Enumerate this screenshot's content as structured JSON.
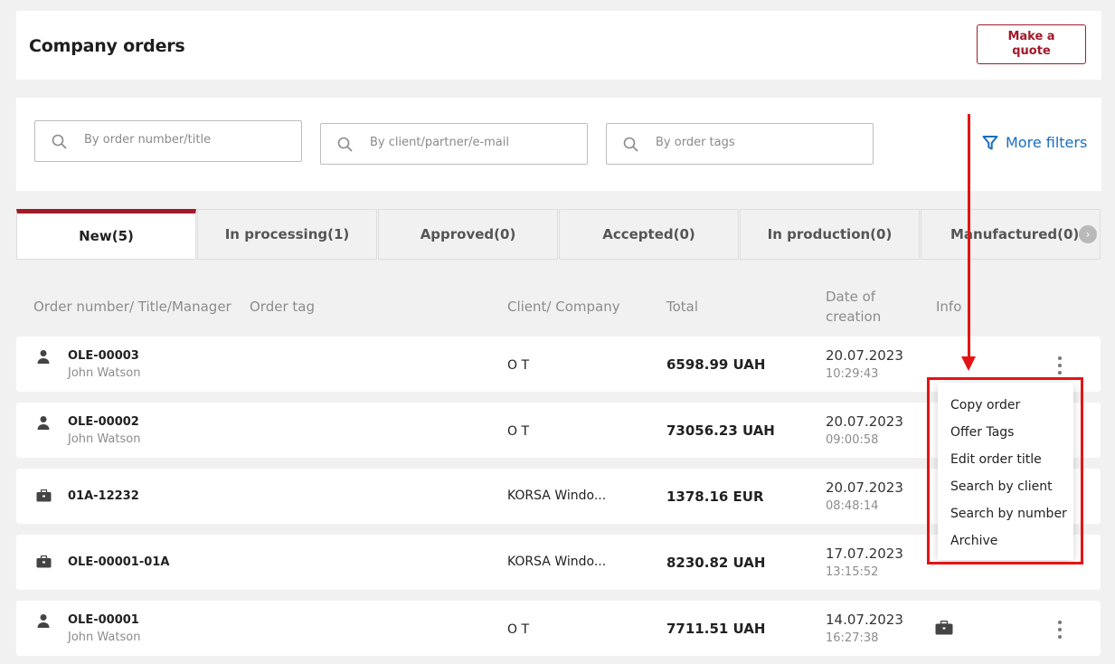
{
  "header": {
    "title": "Company orders",
    "quote_button": "Make a quote"
  },
  "filters": {
    "order_placeholder": "By order number/title",
    "client_placeholder": "By client/partner/e-mail",
    "tags_placeholder": "By order tags",
    "more_filters": "More filters"
  },
  "tabs": [
    {
      "label": "New(5)",
      "active": true
    },
    {
      "label": "In processing(1)"
    },
    {
      "label": "Approved(0)"
    },
    {
      "label": "Accepted(0)"
    },
    {
      "label": "In production(0)"
    },
    {
      "label": "Manufactured(0)"
    }
  ],
  "columns": {
    "order": "Order number/ Title/Manager",
    "tag": "Order tag",
    "client": "Client/ Company",
    "total": "Total",
    "date_line1": "Date of",
    "date_line2": "creation",
    "info": "Info"
  },
  "rows": [
    {
      "icon": "person-icon",
      "number": "OLE-00003",
      "manager": "John Watson",
      "client": "O T",
      "total": "6598.99 UAH",
      "date": "20.07.2023",
      "time": "10:29:43"
    },
    {
      "icon": "person-icon",
      "number": "OLE-00002",
      "manager": "John Watson",
      "client": "O T",
      "total": "73056.23 UAH",
      "date": "20.07.2023",
      "time": "09:00:58"
    },
    {
      "icon": "briefcase-icon",
      "number": "01A-12232",
      "manager": "",
      "client": "KORSA Windo...",
      "total": "1378.16 EUR",
      "date": "20.07.2023",
      "time": "08:48:14"
    },
    {
      "icon": "briefcase-icon",
      "number": "OLE-00001-01A",
      "manager": "",
      "client": "KORSA Windo...",
      "total": "8230.82 UAH",
      "date": "17.07.2023",
      "time": "13:15:52"
    },
    {
      "icon": "person-icon",
      "number": "OLE-00001",
      "manager": "John Watson",
      "client": "O T",
      "total": "7711.51 UAH",
      "date": "14.07.2023",
      "time": "16:27:38"
    }
  ],
  "context_menu": [
    "Copy order",
    "Offer Tags",
    "Edit order title",
    "Search by client",
    "Search by number",
    "Archive"
  ],
  "colors": {
    "brand": "#a11a2a",
    "link": "#1a6dbf",
    "annotation": "#e51414"
  }
}
